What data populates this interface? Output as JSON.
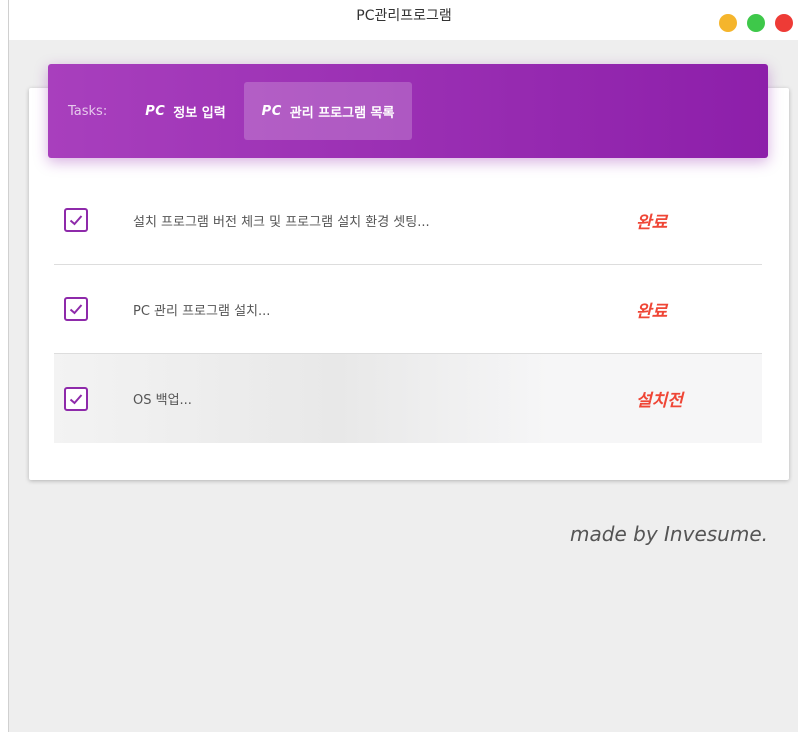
{
  "window": {
    "title": "PC관리프로그램",
    "controls": {
      "minimize_color": "#f5b52c",
      "maximize_color": "#3ec84a",
      "close_color": "#ee3b36"
    }
  },
  "tabs": {
    "label": "Tasks:",
    "items": [
      {
        "icon": "PC",
        "label": "정보 입력",
        "active": false
      },
      {
        "icon": "PC",
        "label": "관리 프로그램 목록",
        "active": true
      }
    ],
    "gradient_colors": [
      "#a83fbd",
      "#8d1faa"
    ]
  },
  "tasks": [
    {
      "checked": true,
      "text": "설치 프로그램 버전 체크 및 프로그램 설치 환경 셋팅...",
      "status": "완료"
    },
    {
      "checked": true,
      "text": "PC 관리 프로그램 설치...",
      "status": "완료"
    },
    {
      "checked": true,
      "text": "OS 백업...",
      "status": "설치전"
    }
  ],
  "colors": {
    "accent": "#8e2aaa",
    "status": "#ef4636"
  },
  "footer": {
    "credit": "made by Invesume."
  }
}
